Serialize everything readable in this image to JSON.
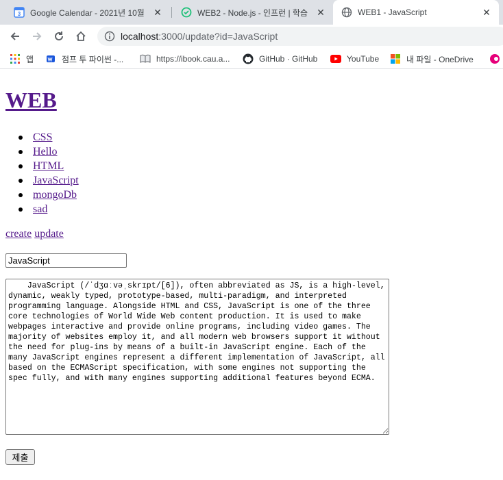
{
  "browser": {
    "tabs": [
      {
        "title": "Google Calendar - 2021년 10월",
        "icon": "google-calendar-icon",
        "active": false
      },
      {
        "title": "WEB2 - Node.js - 인프런 | 학습",
        "icon": "inflearn-icon",
        "active": false
      },
      {
        "title": "WEB1 - JavaScript",
        "icon": "globe-icon",
        "active": true
      }
    ],
    "close_glyph": "✕",
    "address": {
      "host": "localhost",
      "path": ":3000/update?id=JavaScript"
    },
    "bookmarks": [
      {
        "label": "앱",
        "icon": "apps-grid-icon"
      },
      {
        "label": "점프 투 파이썬 -...",
        "icon": "wikidocs-icon"
      },
      {
        "label": "https://ibook.cau.a...",
        "icon": "book-icon"
      },
      {
        "label": "GitHub · GitHub",
        "icon": "github-icon"
      },
      {
        "label": "YouTube",
        "icon": "youtube-icon"
      },
      {
        "label": "내 파일 - OneDrive",
        "icon": "microsoft-icon"
      }
    ],
    "colors": {
      "tabstrip": "#dee1e6",
      "omnibox": "#f1f3f4",
      "youtube": "#ff0000"
    }
  },
  "page": {
    "title": "WEB",
    "topics": [
      "CSS",
      "Hello",
      "HTML",
      "JavaScript",
      "mongoDb",
      "sad"
    ],
    "actions": {
      "create": "create",
      "update": "update"
    },
    "form": {
      "title_value": "JavaScript",
      "description": "    JavaScript (/ˈdʒɑːvəˌskrɪpt/[6]), often abbreviated as JS, is a high-level, dynamic, weakly typed, prototype-based, multi-paradigm, and interpreted programming language. Alongside HTML and CSS, JavaScript is one of the three core technologies of World Wide Web content production. It is used to make webpages interactive and provide online programs, including video games. The majority of websites employ it, and all modern web browsers support it without the need for plug-ins by means of a built-in JavaScript engine. Each of the many JavaScript engines represent a different implementation of JavaScript, all based on the ECMAScript specification, with some engines not supporting the spec fully, and with many engines supporting additional features beyond ECMA.",
      "submit_label": "제출"
    },
    "colors": {
      "visited_link": "#551a8b"
    }
  }
}
